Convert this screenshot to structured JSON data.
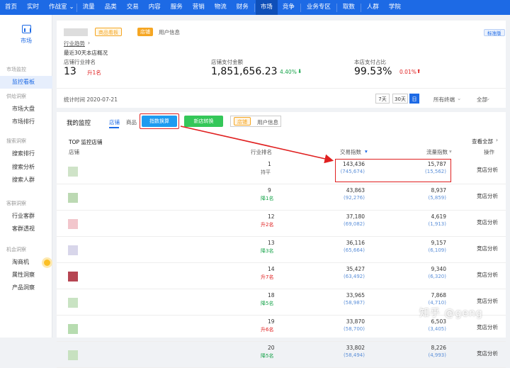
{
  "topnav": [
    "首页",
    "实时",
    "作战室",
    "流量",
    "品类",
    "交易",
    "内容",
    "服务",
    "营销",
    "物流",
    "财务",
    "市场",
    "竞争",
    "业务专区",
    "取数",
    "人群",
    "学院"
  ],
  "sidebar": {
    "brand": "市场",
    "groups": [
      {
        "title": "市场监控",
        "items": [
          "监控看板"
        ]
      },
      {
        "title": "供给洞察",
        "items": [
          "市场大盘",
          "市场排行"
        ]
      },
      {
        "title": "搜索洞察",
        "items": [
          "搜索排行",
          "搜索分析",
          "搜索人群"
        ]
      },
      {
        "title": "客群洞察",
        "items": [
          "行业客群",
          "客群透视"
        ]
      },
      {
        "title": "机会洞察",
        "items": [
          "淘商机",
          "属性洞察",
          "产品洞察"
        ]
      }
    ]
  },
  "overview": {
    "badge_blue": "商品看板",
    "badge_orange": "店铺",
    "user_info": "用户信息",
    "std": "标准版",
    "industry": "行业趋势",
    "period": "最近30天本店概况",
    "rank_label": "店铺行业排名",
    "rank_value": "13",
    "rank_change": "升1名",
    "pay_label": "店铺支付金额",
    "pay_value": "1,851,656.23",
    "pay_change": "4.40%",
    "share_label": "本店支付占比",
    "share_value": "99.53%",
    "share_change": "0.01%"
  },
  "stat": {
    "time": "统计时间 2020-07-21",
    "d7": "7天",
    "d30": "30天",
    "day": "日",
    "terminal": "所有终端",
    "all": "全部"
  },
  "monitor": {
    "title": "我的监控",
    "tab_shop": "店铺",
    "tab_item": "商品",
    "btn_index": "指数换算",
    "btn_newshop": "新店转换",
    "badge": "店铺",
    "user_info": "用户信息",
    "top_title": "TOP 监控店铺",
    "view_all": "查看全部",
    "headers": {
      "shop": "店铺",
      "rank": "行业排名",
      "trade": "交易指数",
      "flow": "流量指数",
      "action": "操作"
    },
    "rows": [
      {
        "rank": "1",
        "change": "持平",
        "trade": "143,436",
        "trade_sub": "(745,674)",
        "flow": "15,787",
        "flow_sub": "(15,562)",
        "action": "竞店分析"
      },
      {
        "rank": "9",
        "change": "降1名",
        "trade": "43,863",
        "trade_sub": "(92,276)",
        "flow": "8,937",
        "flow_sub": "(5,859)",
        "action": "竞店分析"
      },
      {
        "rank": "12",
        "change": "升2名",
        "trade": "37,180",
        "trade_sub": "(69,082)",
        "flow": "4,619",
        "flow_sub": "(1,913)",
        "action": "竞店分析"
      },
      {
        "rank": "13",
        "change": "降3名",
        "trade": "36,116",
        "trade_sub": "(65,664)",
        "flow": "9,157",
        "flow_sub": "(6,109)",
        "action": "竞店分析"
      },
      {
        "rank": "14",
        "change": "升7名",
        "trade": "35,427",
        "trade_sub": "(63,492)",
        "flow": "9,340",
        "flow_sub": "(6,320)",
        "action": "竞店分析"
      },
      {
        "rank": "18",
        "change": "降5名",
        "trade": "33,965",
        "trade_sub": "(58,987)",
        "flow": "7,868",
        "flow_sub": "(4,710)",
        "action": "竞店分析"
      },
      {
        "rank": "19",
        "change": "升6名",
        "trade": "33,870",
        "trade_sub": "(58,700)",
        "flow": "6,503",
        "flow_sub": "(3,405)",
        "action": "竞店分析"
      },
      {
        "rank": "20",
        "change": "降5名",
        "trade": "33,802",
        "trade_sub": "(58,494)",
        "flow": "8,226",
        "flow_sub": "(4,993)",
        "action": "竞店分析"
      }
    ]
  },
  "watermark": "知乎 @geng",
  "colors": {
    "accent": "#1d6ae5",
    "up": "#e02020",
    "down": "#17a34a",
    "highlight": "#e02020"
  }
}
